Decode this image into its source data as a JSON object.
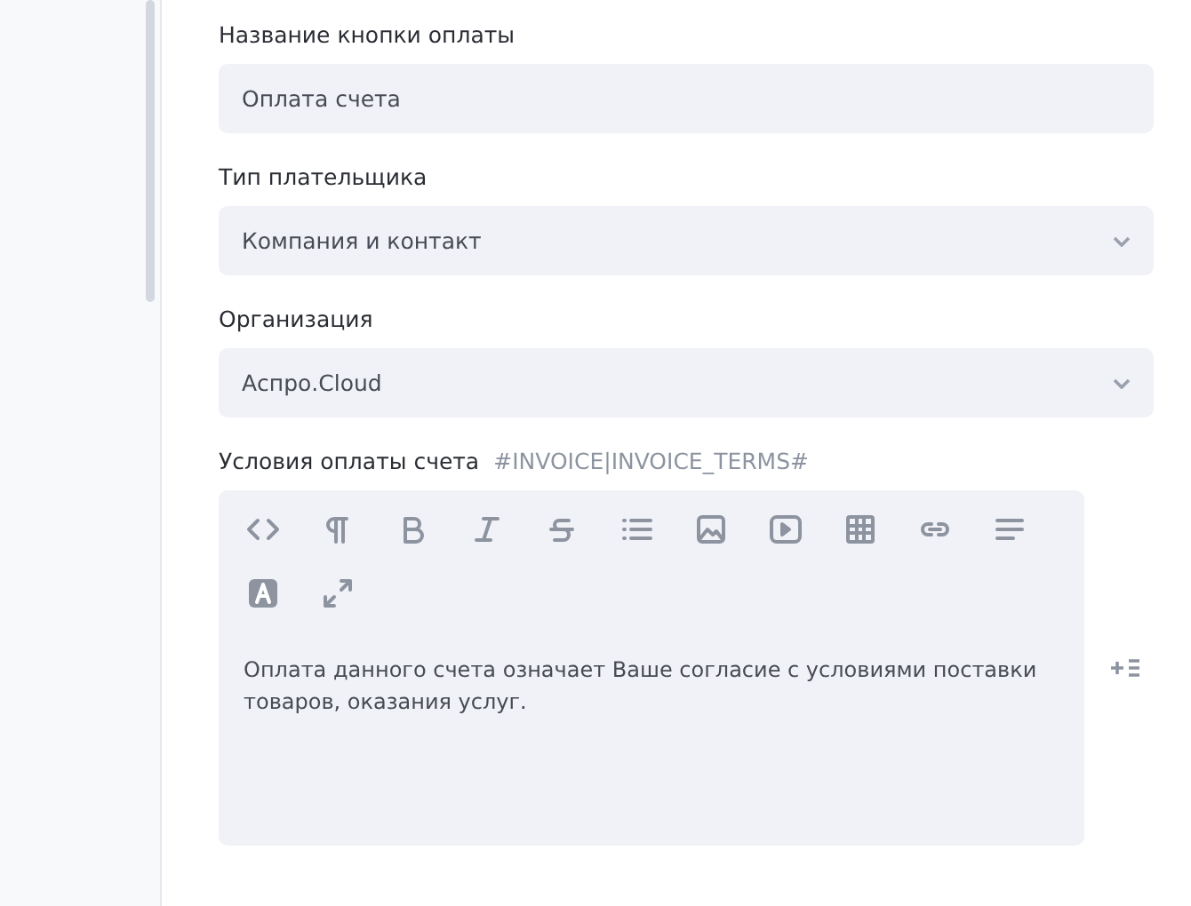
{
  "fields": [
    {
      "kind": "input",
      "label": "Название кнопки оплаты",
      "value": "Оплата счета"
    },
    {
      "kind": "select",
      "label": "Тип плательщика",
      "value": "Компания и контакт"
    },
    {
      "kind": "select",
      "label": "Организация",
      "value": "Аспро.Cloud"
    }
  ],
  "editor": {
    "label": "Условия оплаты счета",
    "tag": "#INVOICE|INVOICE_TERMS#",
    "content": "Оплата данного счета означает Ваше согласие с условиями поставки товаров, оказания услуг."
  }
}
